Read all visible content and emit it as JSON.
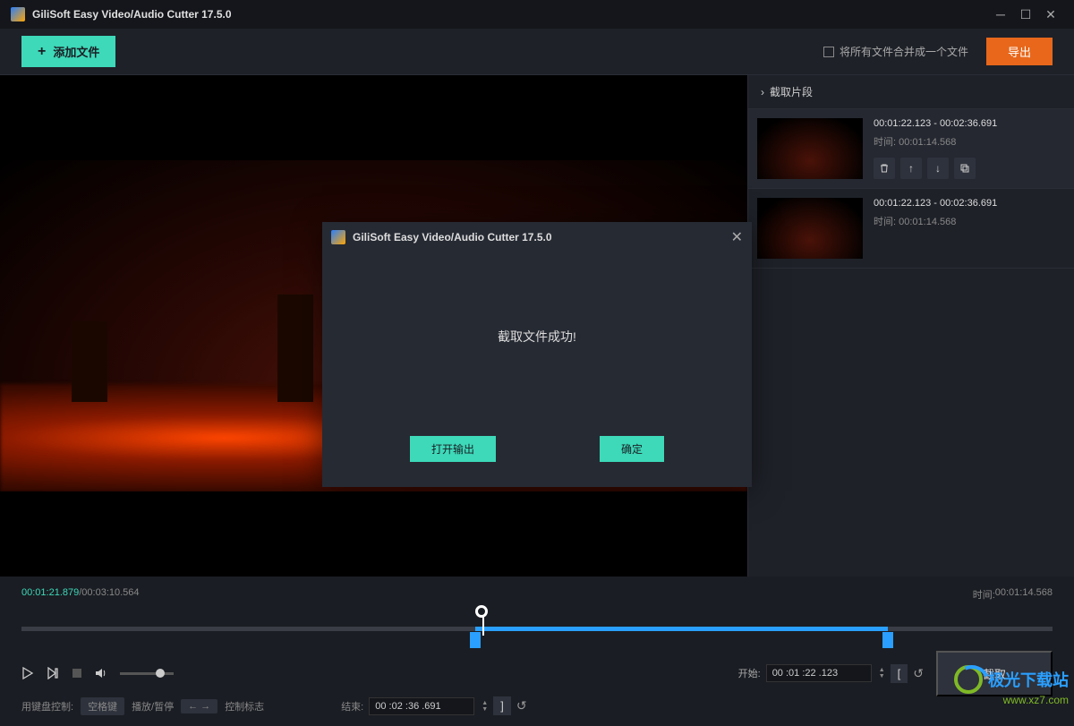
{
  "app": {
    "title": "GiliSoft Easy Video/Audio Cutter 17.5.0"
  },
  "toolbar": {
    "add_file": "添加文件",
    "merge_label": "将所有文件合并成一个文件",
    "export": "导出"
  },
  "segments": {
    "header": "截取片段",
    "time_label": "时间:",
    "items": [
      {
        "range": "00:01:22.123 - 00:02:36.691",
        "duration": "00:01:14.568"
      },
      {
        "range": "00:01:22.123 - 00:02:36.691",
        "duration": "00:01:14.568"
      }
    ]
  },
  "timeline": {
    "current": "00:01:21.879",
    "total": "00:03:10.564",
    "sep": " / ",
    "duration_label": "时间:",
    "duration": "00:01:14.568",
    "start_label": "开始:",
    "end_label": "结束:",
    "start_value": "00 :01 :22 .123",
    "end_value": "00 :02 :36 .691",
    "cut_label": "截取"
  },
  "help": {
    "prefix": "用键盘控制:",
    "space": "空格键",
    "playpause": "播放/暂停",
    "arrows": "← →",
    "marks": "控制标志"
  },
  "dialog": {
    "title": "GiliSoft Easy Video/Audio Cutter 17.5.0",
    "message": "截取文件成功!",
    "open_output": "打开输出",
    "ok": "确定"
  },
  "watermark": {
    "text": "极光下载站",
    "url": "www.xz7.com"
  }
}
